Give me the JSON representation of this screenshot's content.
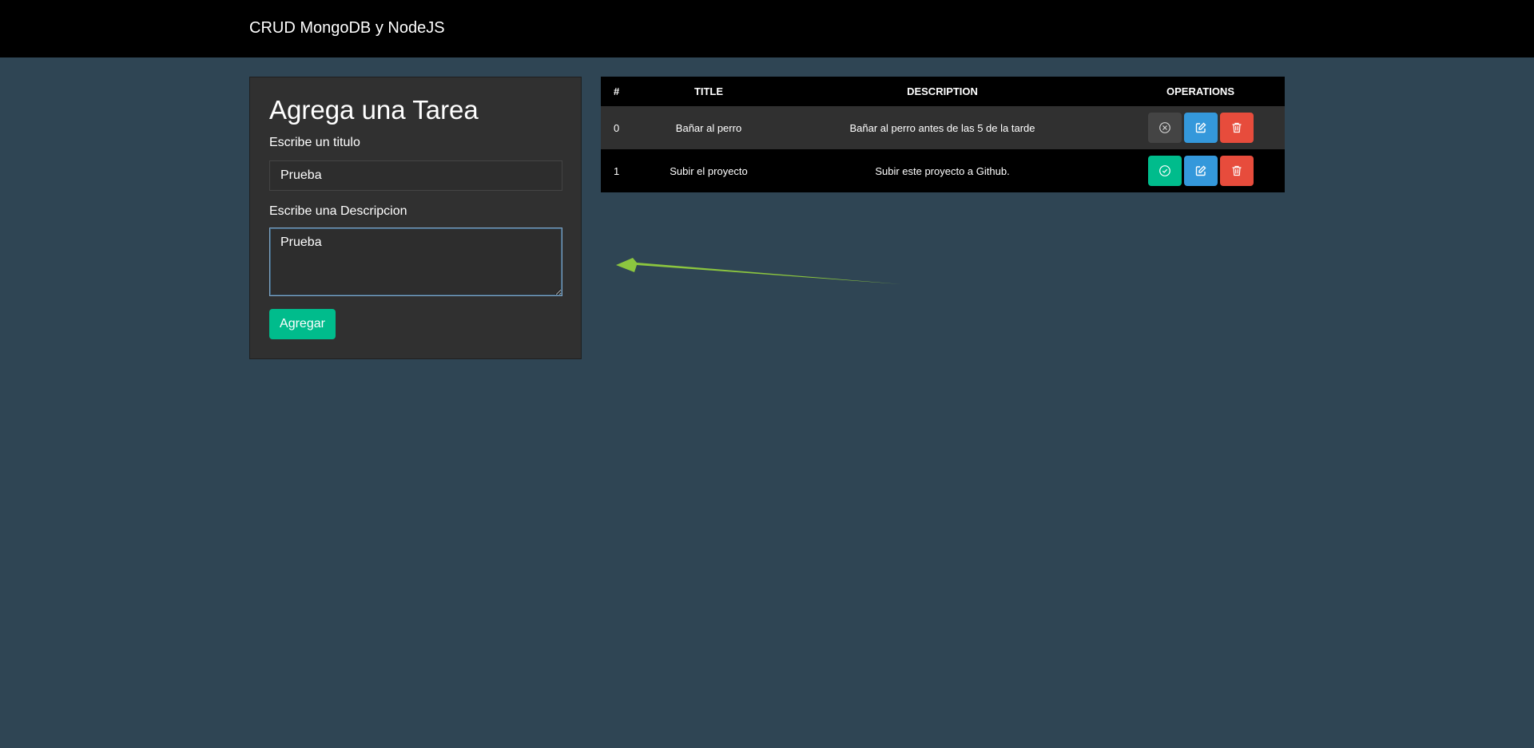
{
  "navbar": {
    "brand": "CRUD MongoDB y NodeJS"
  },
  "form": {
    "heading": "Agrega una Tarea",
    "title_label": "Escribe un titulo",
    "title_value": "Prueba",
    "description_label": "Escribe una Descripcion",
    "description_value": "Prueba",
    "submit_label": "Agregar"
  },
  "table": {
    "headers": {
      "num": "#",
      "title": "TITLE",
      "description": "DESCRIPTION",
      "operations": "OPERATIONS"
    },
    "rows": [
      {
        "num": "0",
        "title": "Bañar al perro",
        "description": "Bañar al perro antes de las 5 de la tarde",
        "status": "pending",
        "toggle_icon": "x-circle-icon"
      },
      {
        "num": "1",
        "title": "Subir el proyecto",
        "description": "Subir este proyecto a Github.",
        "status": "done",
        "toggle_icon": "check-circle-icon"
      }
    ]
  },
  "colors": {
    "background": "#2f4554",
    "navbar": "#000000",
    "card": "#303030",
    "success": "#00bc8c",
    "info": "#3498db",
    "danger": "#e74c3c",
    "secondary": "#444444",
    "annotation_arrow": "#8cc63f"
  }
}
